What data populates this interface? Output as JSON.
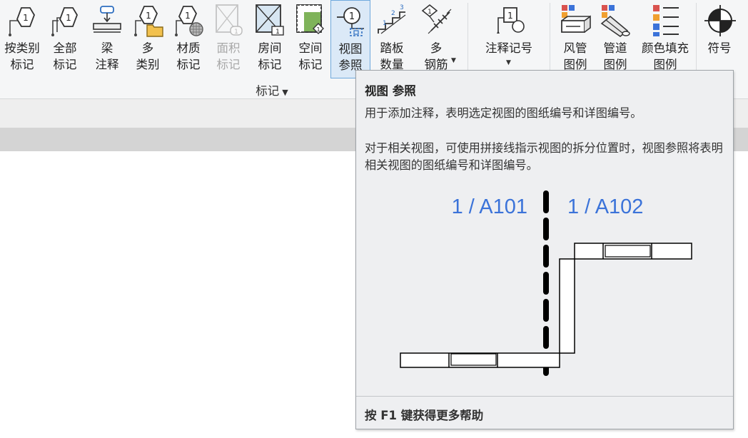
{
  "ribbon": {
    "tools": [
      {
        "id": "tag-by-category",
        "icon": "tag-by-category-icon",
        "label_lines": [
          "按类别",
          "标记"
        ]
      },
      {
        "id": "tag-all",
        "icon": "tag-all-icon",
        "label_lines": [
          "全部",
          "标记"
        ]
      },
      {
        "id": "beam-annotation",
        "icon": "beam-annotation-icon",
        "label_lines": [
          "梁",
          "注释"
        ]
      },
      {
        "id": "multi-category",
        "icon": "multi-category-icon",
        "label_lines": [
          "多",
          "类别"
        ]
      },
      {
        "id": "material-tag",
        "icon": "material-tag-icon",
        "label_lines": [
          "材质",
          "标记"
        ]
      },
      {
        "id": "area-tag",
        "icon": "area-tag-icon",
        "label_lines": [
          "面积",
          "标记"
        ],
        "disabled": true
      },
      {
        "id": "room-tag",
        "icon": "room-tag-icon",
        "label_lines": [
          "房间",
          "标记"
        ]
      },
      {
        "id": "space-tag",
        "icon": "space-tag-icon",
        "label_lines": [
          "空间",
          "标记"
        ]
      },
      {
        "id": "view-reference",
        "icon": "view-reference-icon",
        "label_lines": [
          "视图",
          "参照"
        ],
        "active": true
      },
      {
        "id": "tread-number",
        "icon": "tread-number-icon",
        "label_lines": [
          "踏板",
          "数量"
        ]
      },
      {
        "id": "multi-rebar",
        "icon": "multi-rebar-icon",
        "label_lines": [
          "多",
          "钢筋"
        ],
        "has_dropdown": true
      },
      {
        "id": "keynote",
        "icon": "keynote-icon",
        "label_lines": [
          "注释记号"
        ],
        "has_dropdown": true
      },
      {
        "id": "duct-legend",
        "icon": "duct-legend-icon",
        "label_lines": [
          "风管",
          "图例"
        ]
      },
      {
        "id": "pipe-legend",
        "icon": "pipe-legend-icon",
        "label_lines": [
          "管道",
          "图例"
        ]
      },
      {
        "id": "color-fill-legend",
        "icon": "color-fill-legend-icon",
        "label_lines": [
          "颜色填充",
          "图例"
        ]
      },
      {
        "id": "symbol",
        "icon": "symbol-icon",
        "label_lines": [
          "符号"
        ]
      }
    ],
    "panel_title": "标记",
    "panel_dropdown_icon": "caret-down-icon"
  },
  "tooltip": {
    "title": "视图 参照",
    "description": "用于添加注释，表明选定视图的图纸编号和详图编号。",
    "detail": "对于相关视图，可使用拼接线指示视图的拆分位置时，视图参照将表明相关视图的图纸编号和详图编号。",
    "illustration": {
      "left_reference": "1 / A101",
      "right_reference": "1 / A102",
      "reference_color": "#3b73d9"
    },
    "footer": "按 F1 键获得更多帮助"
  },
  "colors": {
    "ribbon_bg": "#f5f6f7",
    "active_bg": "#dbe9f7",
    "active_border": "#6fa9dd",
    "tooltip_bg": "#eeeff1"
  }
}
